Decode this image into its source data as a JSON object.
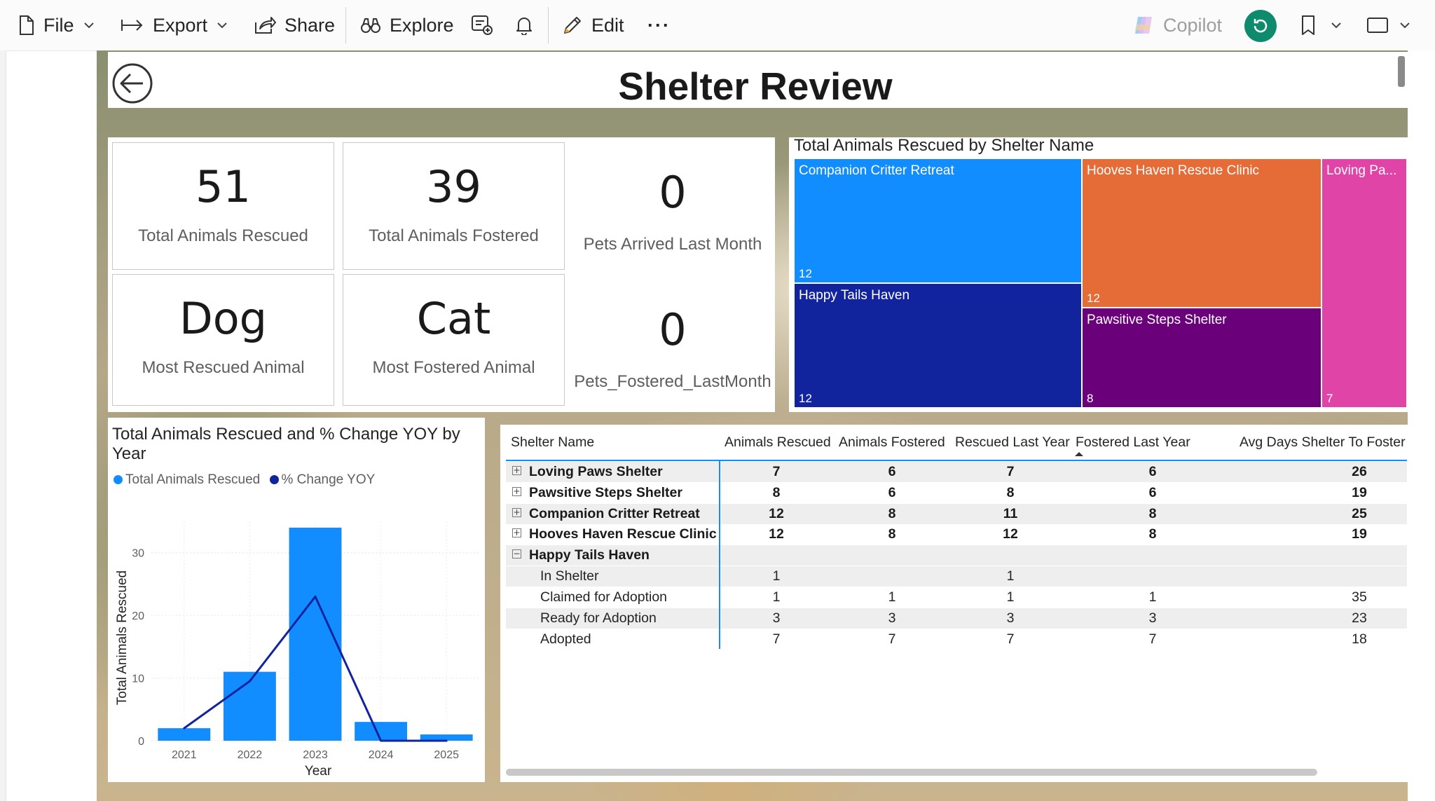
{
  "toolbar": {
    "file": "File",
    "export": "Export",
    "share": "Share",
    "explore": "Explore",
    "edit": "Edit",
    "more": "···",
    "copilot": "Copilot"
  },
  "report": {
    "title": "Shelter Review"
  },
  "kpis": {
    "total_rescued": {
      "value": "51",
      "label": "Total Animals Rescued"
    },
    "total_fostered": {
      "value": "39",
      "label": "Total Animals Fostered"
    },
    "most_rescued": {
      "value": "Dog",
      "label": "Most Rescued Animal"
    },
    "most_fostered": {
      "value": "Cat",
      "label": "Most Fostered Animal"
    },
    "pets_arrived": {
      "value": "0",
      "label": "Pets Arrived Last Month"
    },
    "pets_fostered": {
      "value": "0",
      "label": "Pets_Fostered_LastMonth"
    }
  },
  "treemap": {
    "title": "Total Animals Rescued by Shelter Name",
    "tiles": [
      {
        "name": "Companion Critter Retreat",
        "value": "12",
        "color": "#118dff"
      },
      {
        "name": "Hooves Haven Rescue Clinic",
        "value": "12",
        "color": "#e66c37"
      },
      {
        "name": "Loving Pa...",
        "value": "7",
        "color": "#e044a7"
      },
      {
        "name": "Happy Tails Haven",
        "value": "12",
        "color": "#12239e"
      },
      {
        "name": "Pawsitive Steps Shelter",
        "value": "8",
        "color": "#6b007b"
      }
    ]
  },
  "combo": {
    "title_line1": "Total Animals Rescued and % Change YOY by",
    "title_line2": "Year",
    "legend_rescued": "Total Animals Rescued",
    "legend_change": "% Change YOY",
    "ylabel": "Total Animals Rescued",
    "xlabel": "Year",
    "yticks": [
      "0",
      "10",
      "20",
      "30"
    ],
    "years": [
      "2021",
      "2022",
      "2023",
      "2024",
      "2025"
    ]
  },
  "chart_data": {
    "type": "bar",
    "title": "Total Animals Rescued and % Change YOY by Year",
    "xlabel": "Year",
    "ylabel": "Total Animals Rescued",
    "categories": [
      "2021",
      "2022",
      "2023",
      "2024",
      "2025"
    ],
    "ylim": [
      0,
      35
    ],
    "series": [
      {
        "name": "Total Animals Rescued",
        "type": "bar",
        "color": "#118dff",
        "values": [
          2,
          11,
          34,
          3,
          1
        ]
      },
      {
        "name": "% Change YOY",
        "type": "line",
        "color": "#12239e",
        "values": [
          2,
          9.5,
          23,
          0,
          0
        ]
      }
    ],
    "legend": "top-left",
    "grid": true
  },
  "table": {
    "headers": [
      "Shelter Name",
      "Animals Rescued",
      "Animals Fostered",
      "Rescued Last Year",
      "Fostered Last Year",
      "Avg Days Shelter To Foster"
    ],
    "rows": [
      {
        "name": "Loving Paws Shelter",
        "rescued": "7",
        "fostered": "6",
        "rly": "7",
        "fly": "6",
        "avg": "26"
      },
      {
        "name": "Pawsitive Steps Shelter",
        "rescued": "8",
        "fostered": "6",
        "rly": "8",
        "fly": "6",
        "avg": "19"
      },
      {
        "name": "Companion Critter Retreat",
        "rescued": "12",
        "fostered": "8",
        "rly": "11",
        "fly": "8",
        "avg": "25"
      },
      {
        "name": "Hooves Haven Rescue Clinic",
        "rescued": "12",
        "fostered": "8",
        "rly": "12",
        "fly": "8",
        "avg": "19"
      },
      {
        "name": "Happy Tails Haven",
        "rescued": "",
        "fostered": "",
        "rly": "",
        "fly": "",
        "avg": ""
      }
    ],
    "subrows": [
      {
        "name": "In Shelter",
        "rescued": "1",
        "fostered": "",
        "rly": "1",
        "fly": "",
        "avg": ""
      },
      {
        "name": "Claimed for Adoption",
        "rescued": "1",
        "fostered": "1",
        "rly": "1",
        "fly": "1",
        "avg": "35"
      },
      {
        "name": "Ready for Adoption",
        "rescued": "3",
        "fostered": "3",
        "rly": "3",
        "fly": "3",
        "avg": "23"
      },
      {
        "name": "Adopted",
        "rescued": "7",
        "fostered": "7",
        "rly": "7",
        "fly": "7",
        "avg": "18"
      }
    ]
  }
}
